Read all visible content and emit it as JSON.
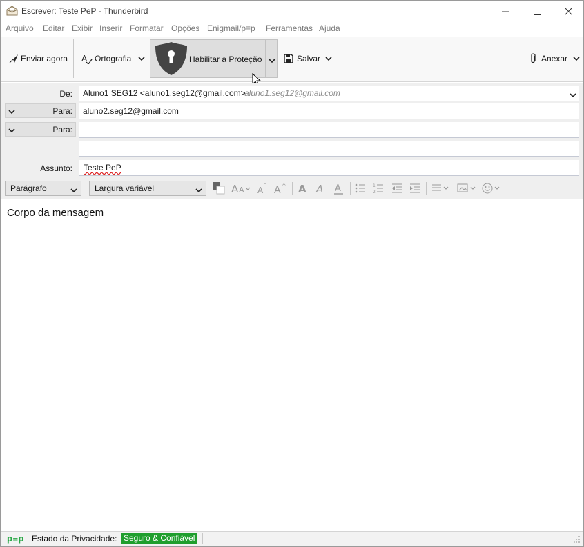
{
  "window": {
    "title": "Escrever: Teste PeP - Thunderbird",
    "controls": {
      "minimize": "—",
      "maximize": "☐",
      "close": "✕"
    }
  },
  "menubar": {
    "items": [
      "Arquivo",
      "Editar",
      "Exibir",
      "Inserir",
      "Formatar",
      "Opções",
      "Enigmail/p≡p",
      "Ferramentas",
      "Ajuda"
    ]
  },
  "toolbar": {
    "send_label": "Enviar agora",
    "spelling_label": "Ortografia",
    "protection_label": "Habilitar a Proteção",
    "save_label": "Salvar",
    "attach_label": "Anexar"
  },
  "header": {
    "from_label": "De:",
    "from_value": "Aluno1 SEG12 <aluno1.seg12@gmail.com>",
    "from_identity_hint": "aluno1.seg12@gmail.com",
    "recipients": [
      {
        "type": "Para:",
        "value": "aluno2.seg12@gmail.com"
      },
      {
        "type": "Para:",
        "value": ""
      }
    ],
    "subject_label": "Assunto:",
    "subject_value": "Teste PeP"
  },
  "format": {
    "paragraph_select": "Parágrafo",
    "font_select": "Largura variável",
    "icons": [
      "text-color-icon",
      "font-size-icon",
      "decrease-font-icon",
      "increase-font-icon",
      "bold-icon",
      "italic-icon",
      "underline-icon",
      "bullet-list-icon",
      "numbered-list-icon",
      "outdent-icon",
      "indent-icon",
      "align-icon",
      "insert-image-icon",
      "emoji-icon"
    ]
  },
  "body": {
    "text": "Corpo da mensagem"
  },
  "status": {
    "logo": "p≡p",
    "privacy_label": "Estado da Privacidade:",
    "privacy_value": "Seguro & Confiável",
    "privacy_color": "#1f9e2d"
  }
}
